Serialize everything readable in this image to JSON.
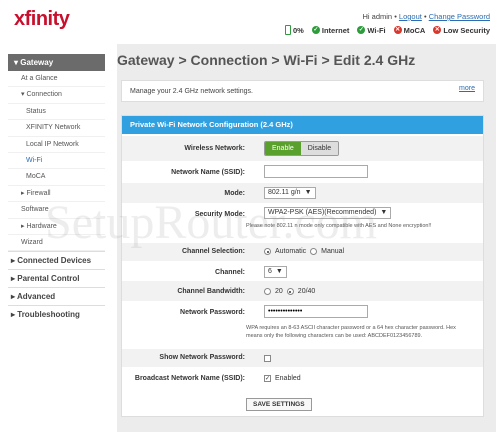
{
  "header": {
    "logo": "xfinity",
    "greeting": "Hi admin",
    "separator1": "•",
    "logout": "Logout",
    "separator2": "•",
    "change_password": "Change Password",
    "status": {
      "battery": "0%",
      "internet": "Internet",
      "wifi": "Wi-Fi",
      "moca": "MoCA",
      "security": "Low Security"
    }
  },
  "sidebar": {
    "gateway": "Gateway",
    "items": [
      "At a Glance",
      "Connection",
      "Status",
      "XFINITY Network",
      "Local IP Network",
      "Wi-Fi",
      "MoCA",
      "Firewall",
      "Software",
      "Hardware",
      "Wizard"
    ],
    "main": [
      "Connected Devices",
      "Parental Control",
      "Advanced",
      "Troubleshooting"
    ]
  },
  "page": {
    "title": "Gateway > Connection > Wi-Fi > Edit 2.4 GHz",
    "description": "Manage your 2.4 GHz network settings.",
    "more": "more"
  },
  "panel": {
    "heading": "Private Wi-Fi Network Configuration (2.4 GHz)",
    "wireless_label": "Wireless Network:",
    "enable": "Enable",
    "disable": "Disable",
    "ssid_label": "Network Name (SSID):",
    "ssid_value": "",
    "mode_label": "Mode:",
    "mode_value": "802.11 g/n",
    "security_label": "Security Mode:",
    "security_value": "WPA2-PSK (AES)(Recommended)",
    "security_note": "Please note 802.11 n mode only compatible with AES and None encryption!!",
    "channel_sel_label": "Channel Selection:",
    "automatic": "Automatic",
    "manual": "Manual",
    "channel_label": "Channel:",
    "channel_value": "6",
    "bandwidth_label": "Channel Bandwidth:",
    "bw20": "20",
    "bw2040": "20/40",
    "password_label": "Network Password:",
    "password_value": "••••••••••••••",
    "password_note": "WPA requires an 8-63 ASCII character password or a 64 hex character password. Hex means only the following characters can be used: ABCDEF0123456789.",
    "show_pw_label": "Show Network Password:",
    "broadcast_label": "Broadcast Network Name (SSID):",
    "enabled": "Enabled",
    "save": "SAVE SETTINGS"
  },
  "watermark": "SetupRouter.com",
  "colors": {
    "brand": "#c8102e",
    "accent": "#30a0e0",
    "enable_green": "#5aa02c",
    "link": "#2a6db2"
  }
}
